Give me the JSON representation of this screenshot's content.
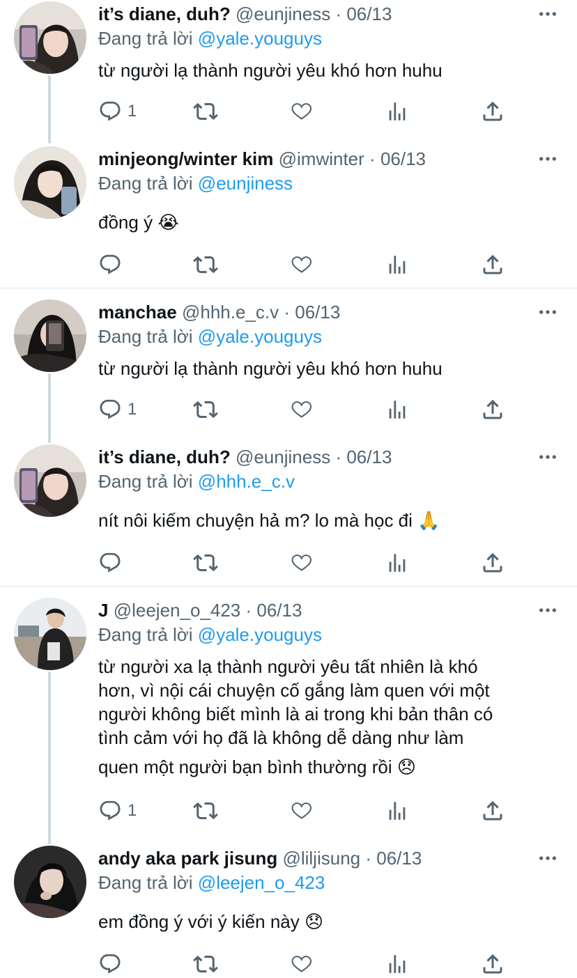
{
  "reply_prefix": "Đang trả lời",
  "tweets": [
    {
      "name": "it’s diane, duh?",
      "handle": "@eunjiness",
      "dot": "·",
      "date": "06/13",
      "reply_to": "@yale.youguys",
      "text": "từ người lạ thành người yêu khó hơn huhu",
      "reply_count": "1"
    },
    {
      "name": "minjeong/winter kim",
      "handle": "@imwinter",
      "dot": "·",
      "date": "06/13",
      "reply_to": "@eunjiness",
      "text": "đồng ý",
      "emoji": "😭",
      "reply_count": ""
    },
    {
      "name": "manchae",
      "handle": "@hhh.e_c.v",
      "dot": "·",
      "date": "06/13",
      "reply_to": "@yale.youguys",
      "text": "từ người lạ thành người yêu khó hơn huhu",
      "reply_count": "1"
    },
    {
      "name": "it’s diane, duh?",
      "handle": "@eunjiness",
      "dot": "·",
      "date": "06/13",
      "reply_to": "@hhh.e_c.v",
      "text": "nít nôi kiếm chuyện hả m? lo mà học đi",
      "emoji": "🙏",
      "reply_count": ""
    },
    {
      "name": "J",
      "handle": "@leejen_o_423",
      "dot": "·",
      "date": "06/13",
      "reply_to": "@yale.youguys",
      "lines": [
        "từ người xa lạ thành người yêu tất nhiên là khó",
        "hơn, vì nội cái chuyện cố gắng làm quen với một",
        "người không biết mình là ai trong khi bản thân có",
        "tình cảm với họ đã là không dễ dàng như làm",
        "quen một người bạn bình thường rồi"
      ],
      "emoji": "😞",
      "reply_count": "1"
    },
    {
      "name": "andy aka park jisung",
      "handle": "@liljisung",
      "dot": "·",
      "date": "06/13",
      "reply_to": "@leejen_o_423",
      "text": "em đồng ý với ý kiến này",
      "emoji": "😞",
      "reply_count": ""
    }
  ],
  "icons": {
    "reply": "reply-icon",
    "retweet": "retweet-icon",
    "like": "like-icon",
    "stats": "stats-icon",
    "share": "share-icon",
    "more": "more-icon"
  },
  "colors": {
    "text": "#0f1419",
    "secondary": "#536471",
    "link": "#1d9bf0",
    "thread_line": "#cfd9de",
    "divider": "#e1e8ed"
  }
}
